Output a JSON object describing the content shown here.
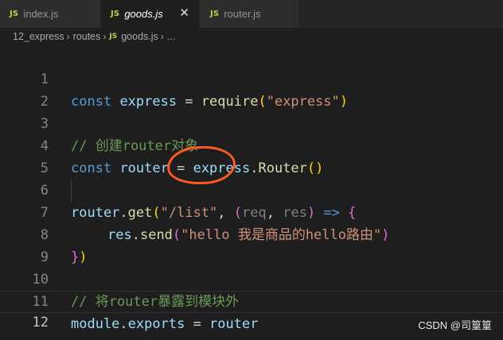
{
  "tabs": [
    {
      "icon": "JS",
      "label": "index.js",
      "active": false
    },
    {
      "icon": "JS",
      "label": "goods.js",
      "active": true,
      "close": "✕"
    },
    {
      "icon": "JS",
      "label": "router.js",
      "active": false
    }
  ],
  "breadcrumb": {
    "folder1": "12_express",
    "folder2": "routes",
    "file_icon": "JS",
    "file": "goods.js",
    "ellipsis": "..."
  },
  "editor": {
    "line_numbers": [
      "1",
      "2",
      "3",
      "4",
      "5",
      "6",
      "7",
      "8",
      "9",
      "10",
      "11",
      "12"
    ],
    "lines": {
      "l1": {
        "kw": "const",
        "var": "express",
        "op": " = ",
        "fn": "require",
        "p1": "(",
        "str": "\"express\"",
        "p2": ")"
      },
      "l3": {
        "comment": "// 创建router对象"
      },
      "l4": {
        "kw": "const",
        "var": "router",
        "op": " = ",
        "obj": "express",
        "dot": ".",
        "fn": "Router",
        "p1": "(",
        "p2": ")"
      },
      "l6": {
        "obj": "router",
        "dot": ".",
        "fn": "get",
        "p1": "(",
        "str": "\"/list\"",
        "comma": ", ",
        "p2": "(",
        "a1": "req",
        "c2": ", ",
        "a2": "res",
        "p3": ")",
        "arrow": " => ",
        "brace": "{"
      },
      "l7": {
        "obj": "res",
        "dot": ".",
        "fn": "send",
        "p1": "(",
        "str": "\"hello 我是商品的hello路由\"",
        "p2": ")"
      },
      "l8": {
        "brace": "}",
        "p": ")"
      },
      "l10": {
        "comment": "// 将router暴露到模块外"
      },
      "l11": {
        "obj": "module",
        "dot": ".",
        "prop": "exports",
        "op": " = ",
        "val": "router"
      }
    }
  },
  "watermark": "CSDN @司篁篁",
  "colors": {
    "background": "#1e1e1e",
    "keyword": "#569cd6",
    "variable": "#9cdcfe",
    "function": "#dcdcaa",
    "string": "#ce9178",
    "comment": "#6a9955",
    "bracket": "#ffd700",
    "annotation_circle": "#ff5a1f"
  }
}
